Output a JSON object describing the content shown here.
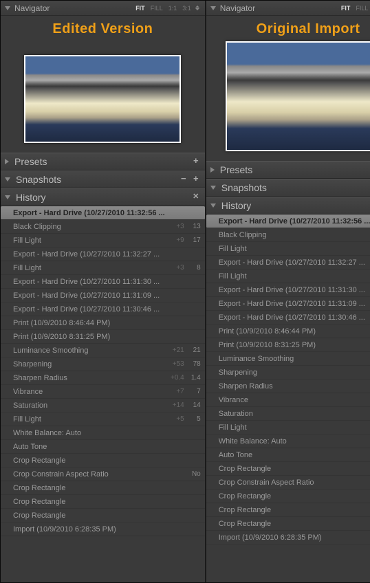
{
  "panels": [
    {
      "caption": "Edited  Version",
      "previewClass": "a",
      "pinnedLast": false
    },
    {
      "caption": "Original  Import",
      "previewClass": "b",
      "pinnedLast": true
    }
  ],
  "navigator": {
    "title": "Navigator",
    "zoom": [
      "FIT",
      "FILL",
      "1:1",
      "3:1"
    ],
    "activeZoom": "FIT"
  },
  "sections": {
    "presets": "Presets",
    "snapshots": "Snapshots",
    "history": "History"
  },
  "history": [
    {
      "label": "Export - Hard Drive (10/27/2010 11:32:56 ...",
      "selected": true
    },
    {
      "label": "Black Clipping",
      "delta": "+3",
      "val": "13"
    },
    {
      "label": "Fill Light",
      "delta": "+9",
      "val": "17"
    },
    {
      "label": "Export - Hard Drive (10/27/2010 11:32:27 ..."
    },
    {
      "label": "Fill Light",
      "delta": "+3",
      "val": "8"
    },
    {
      "label": "Export - Hard Drive (10/27/2010 11:31:30 ..."
    },
    {
      "label": "Export - Hard Drive (10/27/2010 11:31:09 ..."
    },
    {
      "label": "Export - Hard Drive (10/27/2010 11:30:46 ..."
    },
    {
      "label": "Print (10/9/2010 8:46:44 PM)"
    },
    {
      "label": "Print (10/9/2010 8:31:25 PM)"
    },
    {
      "label": "Luminance Smoothing",
      "delta": "+21",
      "val": "21"
    },
    {
      "label": "Sharpening",
      "delta": "+53",
      "val": "78"
    },
    {
      "label": "Sharpen Radius",
      "delta": "+0.4",
      "val": "1.4"
    },
    {
      "label": "Vibrance",
      "delta": "+7",
      "val": "7"
    },
    {
      "label": "Saturation",
      "delta": "+14",
      "val": "14"
    },
    {
      "label": "Fill Light",
      "delta": "+5",
      "val": "5"
    },
    {
      "label": "White Balance: Auto"
    },
    {
      "label": "Auto Tone"
    },
    {
      "label": "Crop Rectangle"
    },
    {
      "label": "Crop Constrain Aspect Ratio",
      "val": "No"
    },
    {
      "label": "Crop Rectangle"
    },
    {
      "label": "Crop Rectangle"
    },
    {
      "label": "Crop Rectangle"
    },
    {
      "label": "Import (10/9/2010 6:28:35 PM)"
    }
  ]
}
